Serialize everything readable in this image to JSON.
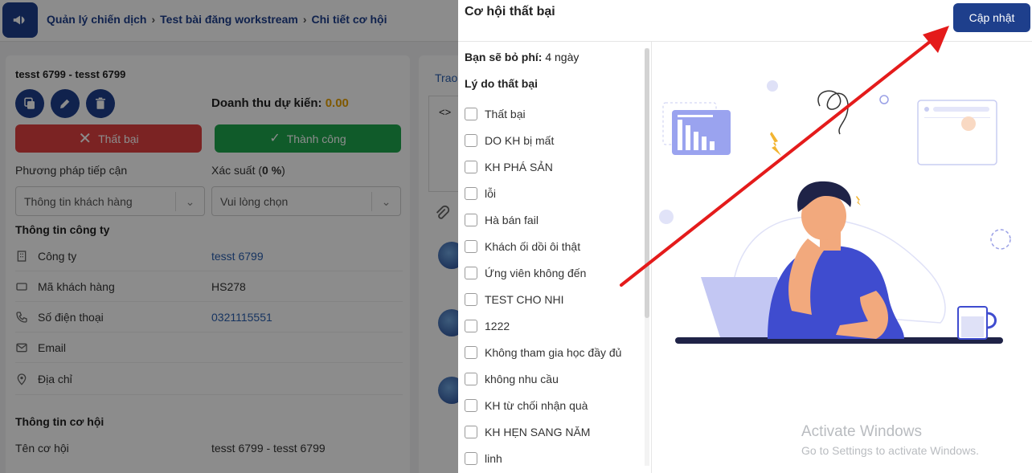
{
  "breadcrumb": {
    "items": [
      "Quản lý chiến dịch",
      "Test bài đăng workstream",
      "Chi tiết cơ hội"
    ]
  },
  "deal": {
    "title": "tesst 6799 - tesst 6799",
    "revenue_label": "Doanh thu dự kiến:",
    "revenue_value": "0.00",
    "fail_label": "Thất bại",
    "success_label": "Thành công",
    "approach_label": "Phương pháp tiếp cận",
    "approach_value": "Thông tin khách hàng",
    "probability_label": "Xác suất (",
    "probability_value": "0 %",
    "probability_end": ")",
    "probability_placeholder": "Vui lòng chọn"
  },
  "company_info": {
    "title": "Thông tin công ty",
    "rows": [
      {
        "label": "Công ty",
        "value": "tesst 6799"
      },
      {
        "label": "Mã khách hàng",
        "value": "HS278"
      },
      {
        "label": "Số điện thoại",
        "value": "0321115551"
      },
      {
        "label": "Email",
        "value": ""
      },
      {
        "label": "Địa chỉ",
        "value": ""
      }
    ]
  },
  "opportunity_info": {
    "title": "Thông tin cơ hội",
    "name_label": "Tên cơ hội",
    "name_value": "tesst 6799 - tesst 6799"
  },
  "right_panel": {
    "tab_label": "Trao",
    "code_icon": "<>"
  },
  "drawer": {
    "title": "Cơ hội thất bại",
    "update_label": "Cập nhật",
    "fee_label": "Bạn sẽ bỏ phí:",
    "fee_value": "4 ngày",
    "reasons_title": "Lý do thất bại",
    "reasons": [
      "Thất bại",
      "DO KH bị mất",
      "KH PHÁ SẢN",
      "lỗi",
      "Hà bán fail",
      "Khách ối dồi ôi thật",
      "Ứng viên không đến",
      "TEST CHO NHI",
      "1222",
      "Không tham gia học đầy đủ",
      "không nhu cầu",
      "KH từ chối nhận quà",
      "KH HẸN SANG NĂM",
      "linh"
    ]
  },
  "watermark": {
    "line1": "Activate Windows",
    "line2": "Go to Settings to activate Windows."
  },
  "colors": {
    "primary": "#1e3f8c",
    "danger": "#e04040",
    "success": "#1ea64e",
    "revenue": "#e8a100",
    "annotation_arrow": "#e41b1b"
  }
}
